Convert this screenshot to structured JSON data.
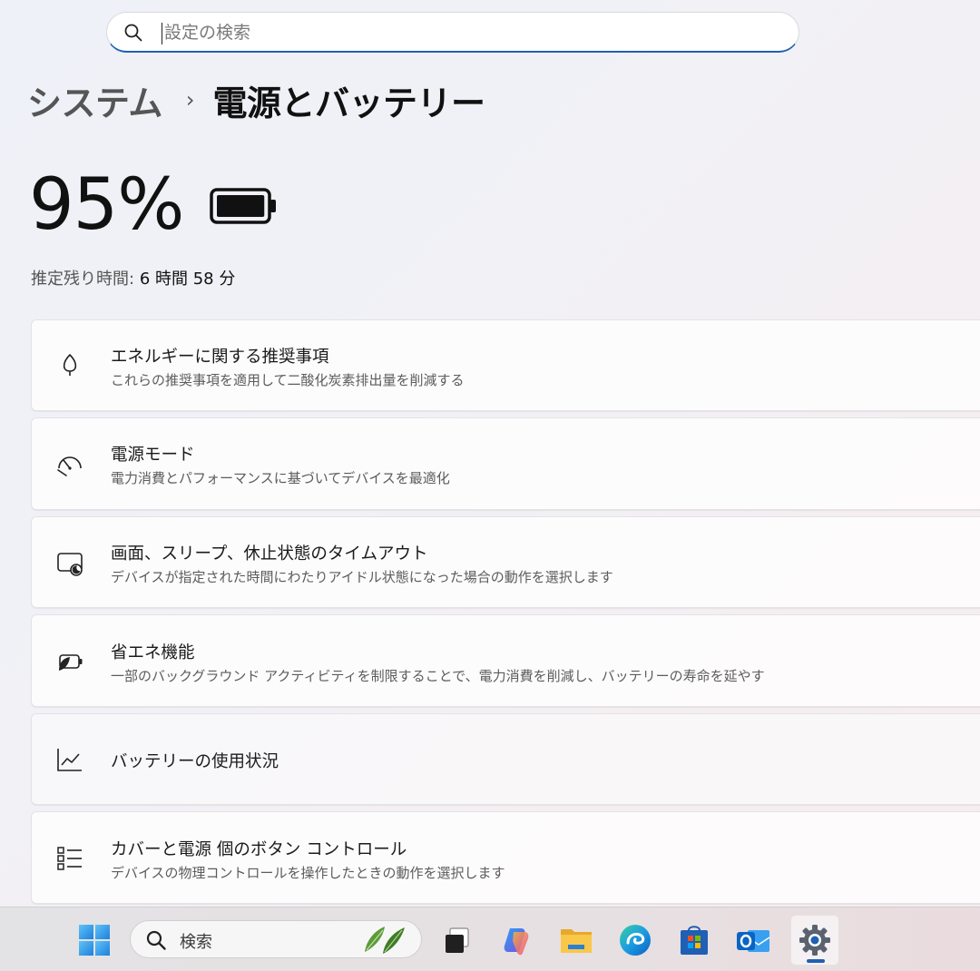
{
  "search": {
    "placeholder": "設定の検索"
  },
  "breadcrumb": {
    "parent": "システム",
    "separator": "›",
    "current": "電源とバッテリー"
  },
  "battery": {
    "percent_text": "95%",
    "level": 0.95,
    "estimate_label": "推定残り時間:",
    "estimate_value": "6 時間 58 分"
  },
  "cards": [
    {
      "title": "エネルギーに関する推奨事項",
      "subtitle": "これらの推奨事項を適用して二酸化炭素排出量を削減する",
      "icon": "leaf-icon"
    },
    {
      "title": "電源モード",
      "subtitle": "電力消費とパフォーマンスに基づいてデバイスを最適化",
      "icon": "gauge-icon"
    },
    {
      "title": "画面、スリープ、休止状態のタイムアウト",
      "subtitle": "デバイスが指定された時間にわたりアイドル状態になった場合の動作を選択します",
      "icon": "screen-sleep-icon"
    },
    {
      "title": "省エネ機能",
      "subtitle": "一部のバックグラウンド アクティビティを制限することで、電力消費を削減し、バッテリーの寿命を延やす",
      "icon": "battery-saver-icon"
    },
    {
      "title": "バッテリーの使用状況",
      "subtitle": "",
      "icon": "chart-icon"
    },
    {
      "title": "カバーと電源 個のボタン コントロール",
      "subtitle": "デバイスの物理コントロールを操作したときの動作を選択します",
      "icon": "list-icon"
    }
  ],
  "taskbar": {
    "search_label": "検索",
    "items": [
      "windows-start-icon",
      "task-view-icon",
      "copilot-icon",
      "file-explorer-icon",
      "edge-icon",
      "store-icon",
      "outlook-icon",
      "settings-icon"
    ],
    "active_item": "settings-icon",
    "accent": "#1f5fb4"
  }
}
